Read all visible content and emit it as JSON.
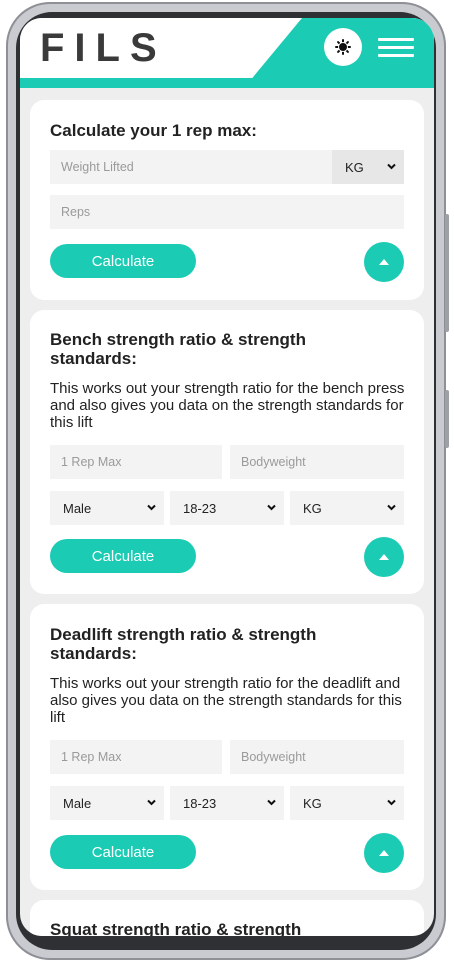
{
  "app": {
    "logo": "FILS"
  },
  "header": {
    "theme_icon": "sun-icon",
    "menu_icon": "hamburger-menu-icon"
  },
  "one_rep_max": {
    "title": "Calculate your 1 rep max:",
    "weight_placeholder": "Weight Lifted",
    "unit": "KG",
    "reps_placeholder": "Reps",
    "calculate": "Calculate"
  },
  "bench": {
    "title": "Bench strength ratio & strength standards:",
    "description": "This works out your strength ratio for the bench press and also gives you data on the strength standards for this lift",
    "rep_max_placeholder": "1 Rep Max",
    "bodyweight_placeholder": "Bodyweight",
    "gender": "Male",
    "age": "18-23",
    "unit": "KG",
    "calculate": "Calculate"
  },
  "deadlift": {
    "title": "Deadlift strength ratio & strength standards:",
    "description": "This works out your strength ratio for the deadlift and also gives you data on the strength standards for this lift",
    "rep_max_placeholder": "1 Rep Max",
    "bodyweight_placeholder": "Bodyweight",
    "gender": "Male",
    "age": "18-23",
    "unit": "KG",
    "calculate": "Calculate"
  },
  "squat": {
    "title": "Squat strength ratio & strength"
  },
  "colors": {
    "accent": "#1ccbb4",
    "background": "#eeeeee",
    "card": "#ffffff",
    "logo": "#3a3a3a"
  }
}
